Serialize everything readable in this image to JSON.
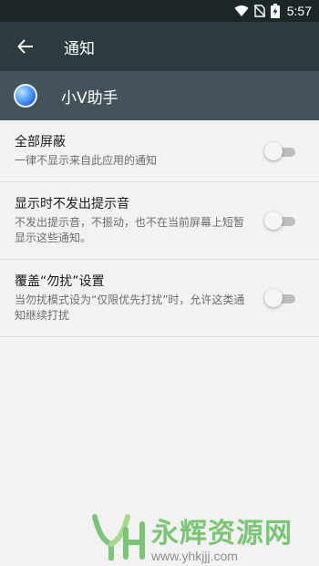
{
  "status_bar": {
    "time": "5:57",
    "icons": [
      "wifi-icon",
      "no-sim-icon",
      "battery-charging-icon"
    ]
  },
  "toolbar": {
    "title": "通知",
    "back_icon": "arrow-left-icon"
  },
  "app": {
    "name": "小V助手",
    "icon": "xiaov-app-icon"
  },
  "settings": [
    {
      "title": "全部屏蔽",
      "summary": "一律不显示来自此应用的通知",
      "enabled": false
    },
    {
      "title": "显示时不发出提示音",
      "summary": "不发出提示音，不振动，也不在当前屏幕上短暂显示这些通知。",
      "enabled": false
    },
    {
      "title": "覆盖“勿扰”设置",
      "summary": "当勿扰模式设为“仅限优先打扰”时，允许这类通知继续打扰",
      "enabled": false
    }
  ],
  "watermark": {
    "text": "永辉资源网",
    "url": "www.yhkjjj.com"
  },
  "colors": {
    "status_bar": "#1d2629",
    "toolbar": "#2e3b41",
    "app_header": "#44535a",
    "background": "#f2f2f2",
    "watermark_green": "#7cc576"
  }
}
